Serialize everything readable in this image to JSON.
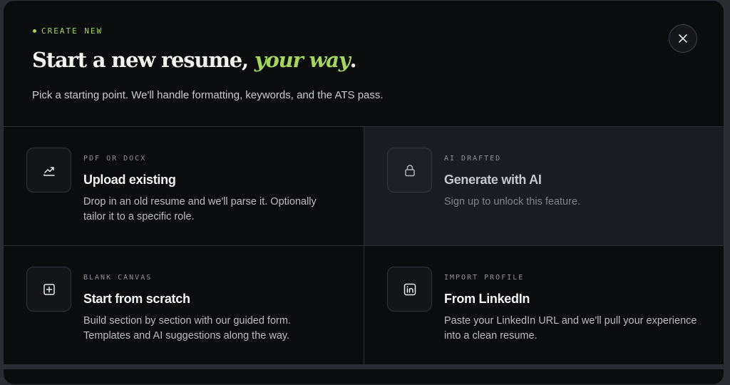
{
  "header": {
    "eyebrow": "CREATE NEW",
    "title_main": "Start a new resume, ",
    "title_accent": "your way",
    "title_end": ".",
    "subtitle": "Pick a starting point. We'll handle formatting, keywords, and the ATS pass.",
    "close_icon": "close-icon"
  },
  "options": [
    {
      "eyebrow": "PDF OR DOCX",
      "title": "Upload existing",
      "description": "Drop in an old resume and we'll parse it. Optionally tailor it to a specific role.",
      "icon": "upload-trend-icon",
      "locked": false
    },
    {
      "eyebrow": "AI DRAFTED",
      "title": "Generate with AI",
      "description": "Sign up to unlock this feature.",
      "icon": "lock-icon",
      "locked": true
    },
    {
      "eyebrow": "BLANK CANVAS",
      "title": "Start from scratch",
      "description": "Build section by section with our guided form. Templates and AI suggestions along the way.",
      "icon": "plus-square-icon",
      "locked": false
    },
    {
      "eyebrow": "IMPORT PROFILE",
      "title": "From LinkedIn",
      "description": "Paste your LinkedIn URL and we'll pull your experience into a clean resume.",
      "icon": "linkedin-icon",
      "locked": false
    }
  ],
  "colors": {
    "accent": "#a3d65a",
    "background": "#0b0c0e",
    "locked_card": "#1b1d22"
  }
}
